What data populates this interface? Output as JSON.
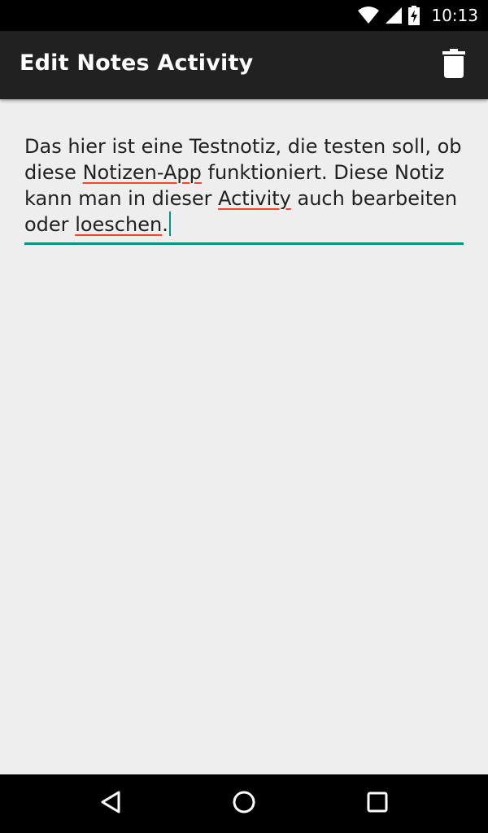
{
  "status_bar": {
    "time": "10:13",
    "icons": [
      "wifi-icon",
      "signal-icon",
      "battery-charging-icon"
    ]
  },
  "app_bar": {
    "title": "Edit Notes Activity",
    "action_icon": "trash-icon"
  },
  "note": {
    "segments": [
      {
        "text": "Das hier ist eine Testnotiz, die testen soll, ob diese ",
        "misspelled": false
      },
      {
        "text": "Notizen-App",
        "misspelled": true
      },
      {
        "text": " funktioniert. Diese Notiz kann man in dieser ",
        "misspelled": false
      },
      {
        "text": "Activity",
        "misspelled": true
      },
      {
        "text": " auch bearbeiten oder ",
        "misspelled": false
      },
      {
        "text": "loeschen",
        "misspelled": true
      },
      {
        "text": ".",
        "misspelled": false
      }
    ]
  },
  "nav_bar": {
    "buttons": [
      "back-icon",
      "home-icon",
      "recents-icon"
    ]
  },
  "colors": {
    "accent": "#009688",
    "app_bar": "#212121",
    "background": "#eeeeee",
    "spellcheck": "#f44336"
  }
}
